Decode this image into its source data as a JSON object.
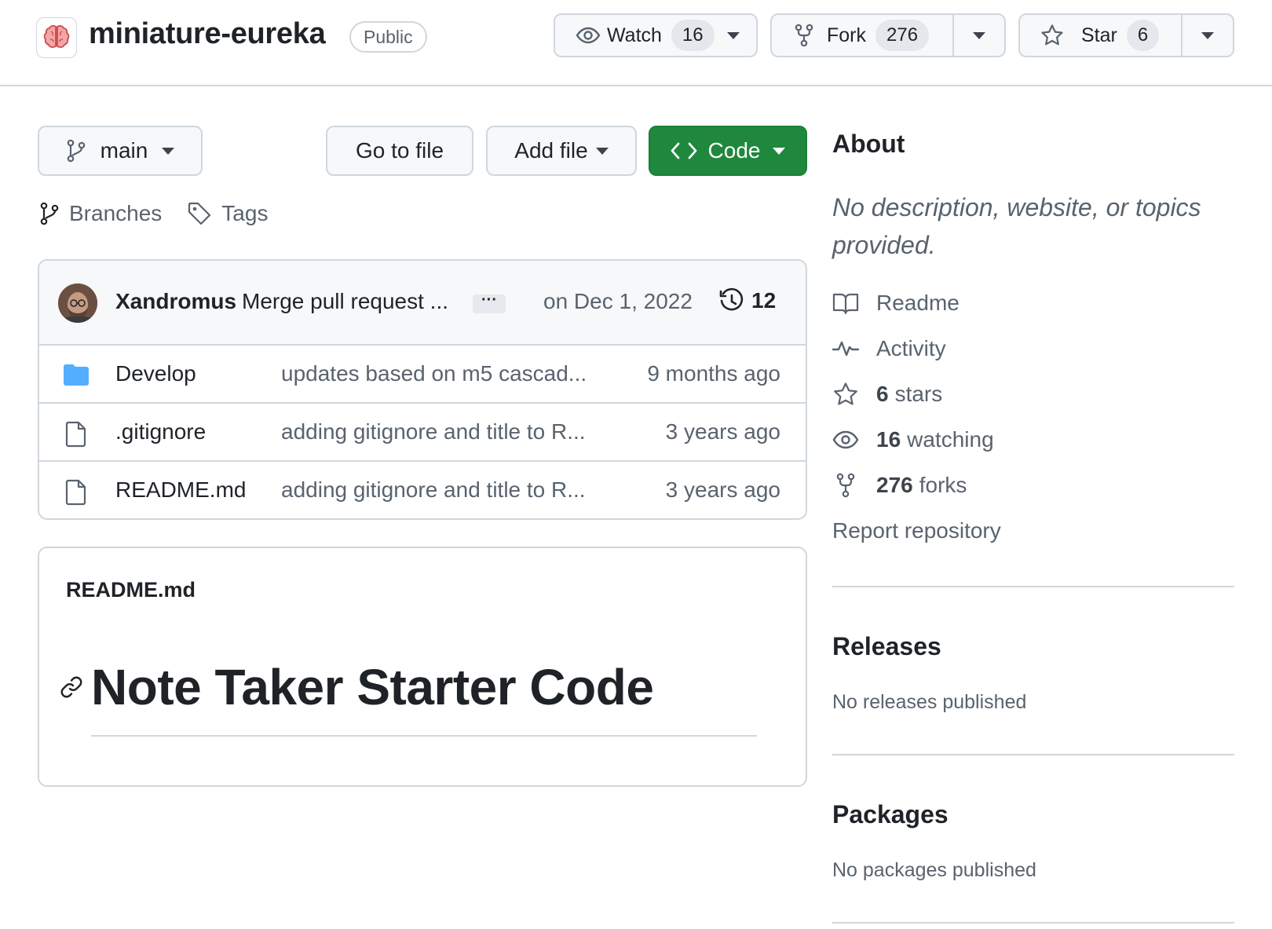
{
  "repo": {
    "name": "miniature-eureka",
    "visibility": "Public"
  },
  "actions": {
    "watch": {
      "label": "Watch",
      "count": "16"
    },
    "fork": {
      "label": "Fork",
      "count": "276"
    },
    "star": {
      "label": "Star",
      "count": "6"
    }
  },
  "toolbar": {
    "branch": "main",
    "go_to_file": "Go to file",
    "add_file": "Add file",
    "code": "Code"
  },
  "ref_links": {
    "branches": "Branches",
    "tags": "Tags"
  },
  "latest_commit": {
    "author": "Xandromus",
    "message": "Merge pull request ...",
    "ellipsis": "···",
    "date": "on Dec 1, 2022",
    "commit_count": "12"
  },
  "files": [
    {
      "name": "Develop",
      "type": "folder",
      "commit": "updates based on m5 cascad...",
      "age": "9 months ago"
    },
    {
      "name": ".gitignore",
      "type": "file",
      "commit": "adding gitignore and title to R...",
      "age": "3 years ago"
    },
    {
      "name": "README.md",
      "type": "file",
      "commit": "adding gitignore and title to R...",
      "age": "3 years ago"
    }
  ],
  "readme": {
    "filename": "README.md",
    "heading": "Note Taker Starter Code"
  },
  "about": {
    "title": "About",
    "description": "No description, website, or topics provided.",
    "readme": "Readme",
    "activity": "Activity",
    "stars_count": "6",
    "stars_label": "stars",
    "watching_count": "16",
    "watching_label": "watching",
    "forks_count": "276",
    "forks_label": "forks",
    "report": "Report repository"
  },
  "releases": {
    "title": "Releases",
    "note": "No releases published"
  },
  "packages": {
    "title": "Packages",
    "note": "No packages published"
  },
  "colors": {
    "code_button": "#1f883d",
    "folder": "#54aeff",
    "border": "#d0d7de",
    "muted_text": "#59636e"
  }
}
